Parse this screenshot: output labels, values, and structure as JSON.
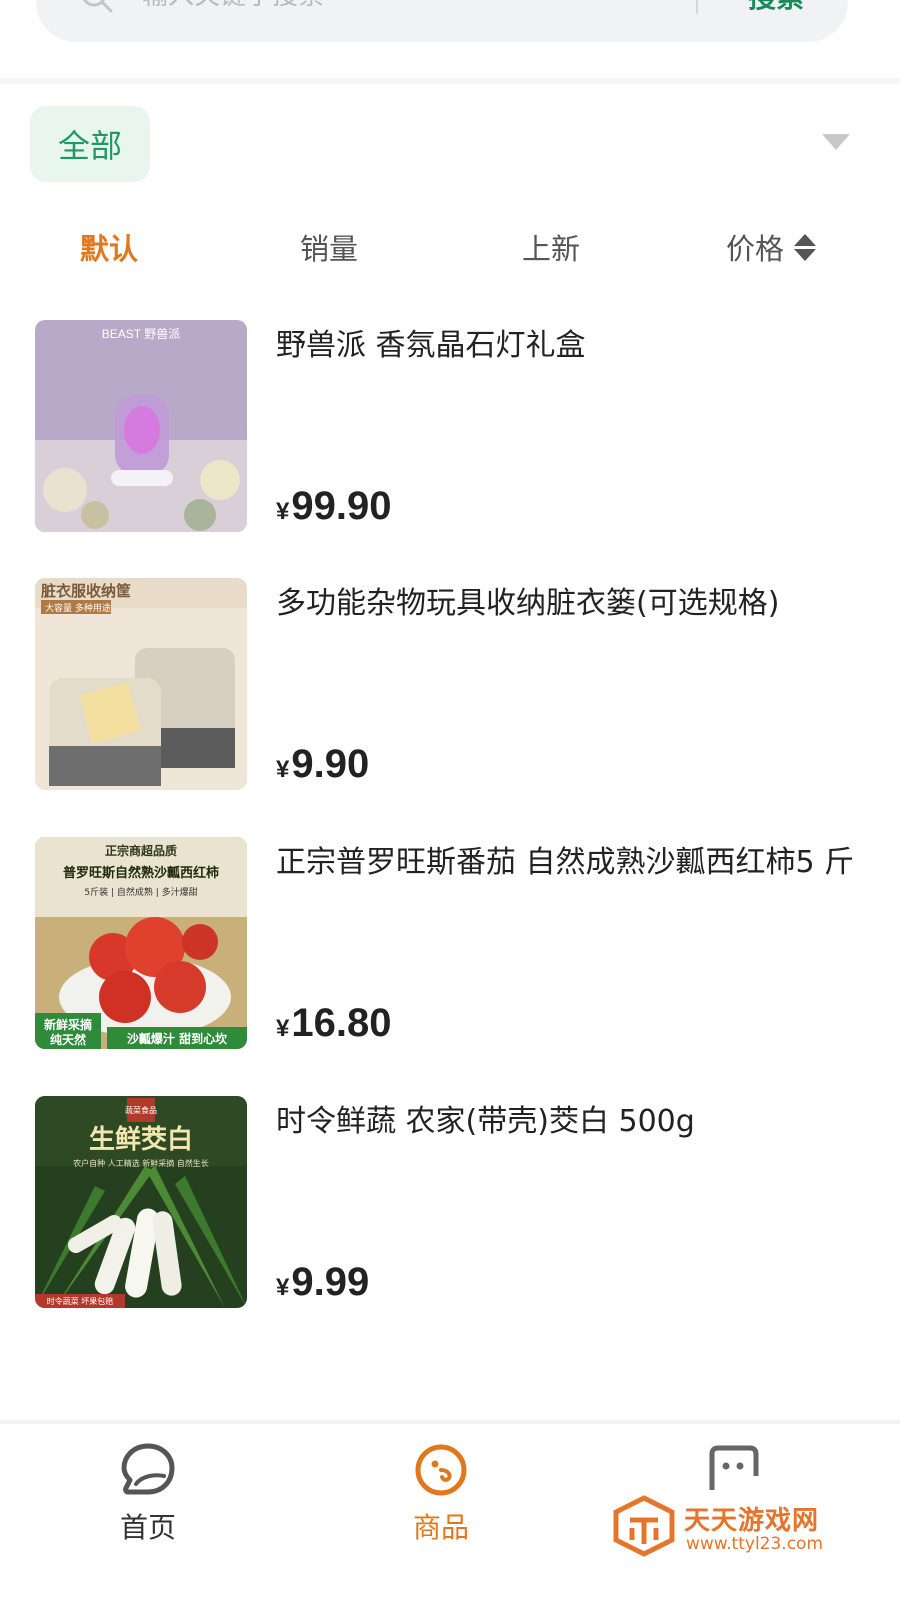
{
  "search": {
    "placeholder": "输入关键字搜索",
    "button_label": "搜索"
  },
  "category": {
    "selected": "全部"
  },
  "sort_tabs": [
    {
      "label": "默认",
      "active": true
    },
    {
      "label": "销量",
      "active": false
    },
    {
      "label": "上新",
      "active": false
    },
    {
      "label": "价格",
      "active": false
    }
  ],
  "products": [
    {
      "name": "野兽派 香氛晶石灯礼盒",
      "currency": "¥",
      "price": "99.90",
      "image_text": [
        "BEAST 野兽派"
      ]
    },
    {
      "name": "多功能杂物玩具收纳脏衣篓(可选规格)",
      "currency": "¥",
      "price": "9.90",
      "image_text": [
        "脏衣服收纳筐",
        "大容量 多种用途"
      ]
    },
    {
      "name": "正宗普罗旺斯番茄 自然成熟沙瓤西红柿5 斤",
      "currency": "¥",
      "price": "16.80",
      "image_text": [
        "正宗商超品质",
        "普罗旺斯自然熟沙瓤西红柿",
        "5斤装 | 自然成熟 | 多汁爆甜",
        "新鲜采摘",
        "纯天然",
        "沙瓤爆汁 甜到心坎"
      ]
    },
    {
      "name": "时令鲜蔬 农家(带壳)茭白 500g",
      "currency": "¥",
      "price": "9.99",
      "image_text": [
        "蔬菜食品",
        "生鲜茭白",
        "农户自种 人工精选 新鲜采摘 自然生长",
        "时令蔬菜 坏果包赔"
      ]
    }
  ],
  "bottom_nav": [
    {
      "label": "首页",
      "icon": "home-icon",
      "active": false
    },
    {
      "label": "商品",
      "icon": "goods-icon",
      "active": true
    },
    {
      "label": "",
      "icon": "message-icon",
      "active": false
    }
  ],
  "watermark": {
    "title": "天天游戏网",
    "url": "www.ttyl23.com"
  },
  "colors": {
    "accent": "#e2781d",
    "green": "#1f9a5e",
    "chip_bg": "#e8f6ee",
    "search_bg": "#f1f2f4"
  }
}
